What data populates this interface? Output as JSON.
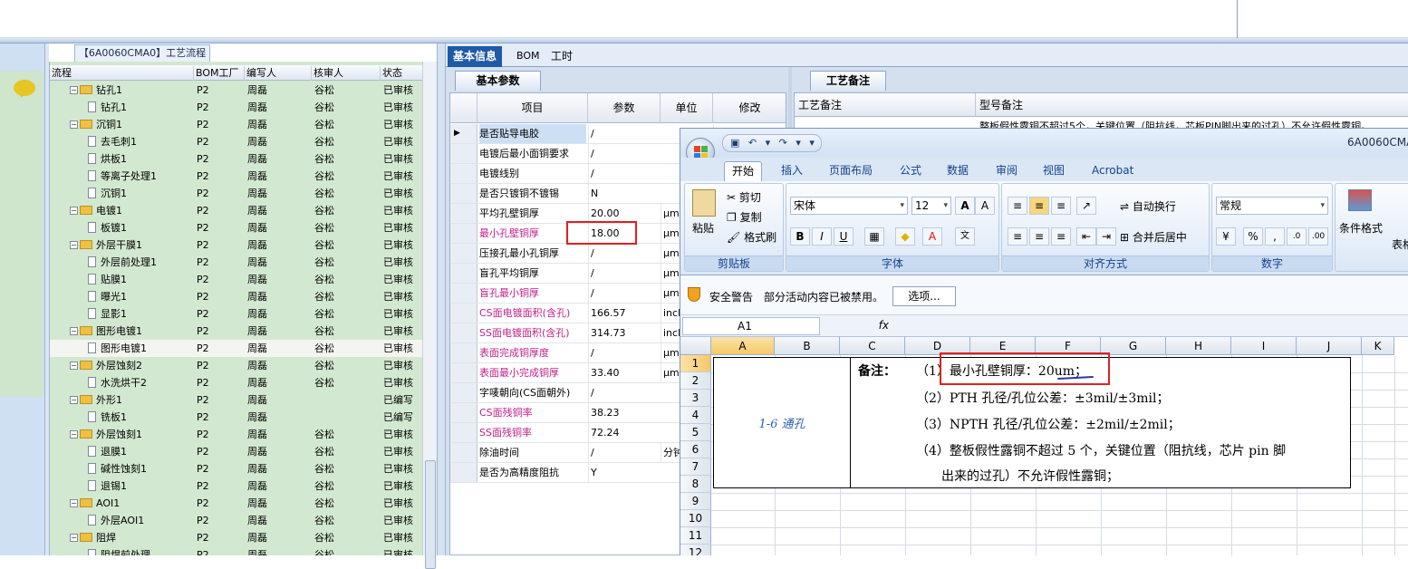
{
  "tree": {
    "title": "【6A0060CMA0】工艺流程",
    "headers": [
      "流程",
      "BOM工厂",
      "编写人",
      "核审人",
      "状态"
    ],
    "rows": [
      {
        "name": "钻孔1",
        "level": 1,
        "bom": "P2",
        "author": "周磊",
        "reviewer": "谷松",
        "status": "已审核"
      },
      {
        "name": "钻孔1",
        "level": 2,
        "bom": "P2",
        "author": "周磊",
        "reviewer": "谷松",
        "status": "已审核"
      },
      {
        "name": "沉铜1",
        "level": 1,
        "bom": "P2",
        "author": "周磊",
        "reviewer": "谷松",
        "status": "已审核"
      },
      {
        "name": "去毛刺1",
        "level": 2,
        "bom": "P2",
        "author": "周磊",
        "reviewer": "谷松",
        "status": "已审核"
      },
      {
        "name": "烘板1",
        "level": 2,
        "bom": "P2",
        "author": "周磊",
        "reviewer": "谷松",
        "status": "已审核"
      },
      {
        "name": "等离子处理1",
        "level": 2,
        "bom": "P2",
        "author": "周磊",
        "reviewer": "谷松",
        "status": "已审核"
      },
      {
        "name": "沉铜1",
        "level": 2,
        "bom": "P2",
        "author": "周磊",
        "reviewer": "谷松",
        "status": "已审核"
      },
      {
        "name": "电镀1",
        "level": 1,
        "bom": "P2",
        "author": "周磊",
        "reviewer": "谷松",
        "status": "已审核"
      },
      {
        "name": "板镀1",
        "level": 2,
        "bom": "P2",
        "author": "周磊",
        "reviewer": "谷松",
        "status": "已审核"
      },
      {
        "name": "外层干膜1",
        "level": 1,
        "bom": "P2",
        "author": "周磊",
        "reviewer": "谷松",
        "status": "已审核"
      },
      {
        "name": "外层前处理1",
        "level": 2,
        "bom": "P2",
        "author": "周磊",
        "reviewer": "谷松",
        "status": "已审核"
      },
      {
        "name": "贴膜1",
        "level": 2,
        "bom": "P2",
        "author": "周磊",
        "reviewer": "谷松",
        "status": "已审核"
      },
      {
        "name": "曝光1",
        "level": 2,
        "bom": "P2",
        "author": "周磊",
        "reviewer": "谷松",
        "status": "已审核"
      },
      {
        "name": "显影1",
        "level": 2,
        "bom": "P2",
        "author": "周磊",
        "reviewer": "谷松",
        "status": "已审核"
      },
      {
        "name": "图形电镀1",
        "level": 1,
        "bom": "P2",
        "author": "周磊",
        "reviewer": "谷松",
        "status": "已审核"
      },
      {
        "name": "图形电镀1",
        "level": 2,
        "bom": "P2",
        "author": "周磊",
        "reviewer": "谷松",
        "status": "已审核"
      },
      {
        "name": "外层蚀刻2",
        "level": 1,
        "bom": "P2",
        "author": "周磊",
        "reviewer": "谷松",
        "status": "已审核"
      },
      {
        "name": "水洗烘干2",
        "level": 2,
        "bom": "P2",
        "author": "周磊",
        "reviewer": "谷松",
        "status": "已审核"
      },
      {
        "name": "外形1",
        "level": 1,
        "bom": "P2",
        "author": "周磊",
        "reviewer": "",
        "status": "已编写"
      },
      {
        "name": "铣板1",
        "level": 2,
        "bom": "P2",
        "author": "周磊",
        "reviewer": "",
        "status": "已编写"
      },
      {
        "name": "外层蚀刻1",
        "level": 1,
        "bom": "P2",
        "author": "周磊",
        "reviewer": "谷松",
        "status": "已审核"
      },
      {
        "name": "退膜1",
        "level": 2,
        "bom": "P2",
        "author": "周磊",
        "reviewer": "谷松",
        "status": "已审核"
      },
      {
        "name": "碱性蚀刻1",
        "level": 2,
        "bom": "P2",
        "author": "周磊",
        "reviewer": "谷松",
        "status": "已审核"
      },
      {
        "name": "退锡1",
        "level": 2,
        "bom": "P2",
        "author": "周磊",
        "reviewer": "谷松",
        "status": "已审核"
      },
      {
        "name": "AOI1",
        "level": 1,
        "bom": "P2",
        "author": "周磊",
        "reviewer": "谷松",
        "status": "已审核"
      },
      {
        "name": "外层AOI1",
        "level": 2,
        "bom": "P2",
        "author": "周磊",
        "reviewer": "谷松",
        "status": "已审核"
      },
      {
        "name": "阻焊",
        "level": 1,
        "bom": "P2",
        "author": "周磊",
        "reviewer": "谷松",
        "status": "已审核"
      },
      {
        "name": "阻焊前处理",
        "level": 2,
        "bom": "P2",
        "author": "周磊",
        "reviewer": "谷松",
        "status": "已审核"
      }
    ]
  },
  "tabs": [
    "基本信息",
    "BOM",
    "工时"
  ],
  "params": {
    "tab": "基本参数",
    "headers": [
      "项目",
      "参数",
      "单位",
      "修改"
    ],
    "rows": [
      {
        "name": "是否贴导电胶",
        "value": "/",
        "unit": "",
        "pink": false
      },
      {
        "name": "电镀后最小面铜要求",
        "value": "/",
        "unit": "",
        "pink": false
      },
      {
        "name": "电镀线别",
        "value": "/",
        "unit": "",
        "pink": false
      },
      {
        "name": "是否只镀铜不镀锡",
        "value": "N",
        "unit": "",
        "pink": false
      },
      {
        "name": "平均孔壁铜厚",
        "value": "20.00",
        "unit": "μm",
        "pink": false
      },
      {
        "name": "最小孔壁铜厚",
        "value": "18.00",
        "unit": "μm",
        "pink": true
      },
      {
        "name": "压接孔最小孔铜厚",
        "value": "/",
        "unit": "μm",
        "pink": false
      },
      {
        "name": "盲孔平均铜厚",
        "value": "/",
        "unit": "μm",
        "pink": false
      },
      {
        "name": "盲孔最小铜厚",
        "value": "/",
        "unit": "μm",
        "pink": true
      },
      {
        "name": "CS面电镀面积(含孔)",
        "value": "166.57",
        "unit": "inch",
        "pink": true
      },
      {
        "name": "SS面电镀面积(含孔)",
        "value": "314.73",
        "unit": "inch",
        "pink": true
      },
      {
        "name": "表面完成铜厚度",
        "value": "/",
        "unit": "μm",
        "pink": true
      },
      {
        "name": "表面最小完成铜厚",
        "value": "33.40",
        "unit": "μm",
        "pink": true
      },
      {
        "name": "字唛朝向(CS面朝外)",
        "value": "/",
        "unit": "",
        "pink": false
      },
      {
        "name": "CS面残铜率",
        "value": "38.23",
        "unit": "",
        "pink": true
      },
      {
        "name": "SS面残铜率",
        "value": "72.24",
        "unit": "",
        "pink": true
      },
      {
        "name": "除油时间",
        "value": "/",
        "unit": "分钟",
        "pink": false
      },
      {
        "name": "是否为高精度阻抗",
        "value": "Y",
        "unit": "",
        "pink": false
      }
    ]
  },
  "remarks": {
    "tab": "工艺备注",
    "headers": [
      "工艺备注",
      "型号备注"
    ],
    "line": "整板假性露铜不超过5个，关键位置（阻抗线，芯板PIN脚出来的过孔）不允许假性露铜。"
  },
  "excel": {
    "doc_title": "6A0060CMA",
    "qat": "▣ ↶ ▾ ↷ ▾ ▾",
    "tabs": [
      "开始",
      "插入",
      "页面布局",
      "公式",
      "数据",
      "审阅",
      "视图",
      "Acrobat"
    ],
    "clipboard": {
      "paste": "粘贴",
      "cut": "剪切",
      "copy": "复制",
      "format_painter": "格式刷",
      "label": "剪贴板"
    },
    "font": {
      "name": "宋体",
      "size": "12",
      "label": "字体"
    },
    "alignment": {
      "wrap": "自动换行",
      "merge": "合并后居中",
      "label": "对齐方式"
    },
    "number": {
      "format": "常规",
      "label": "数字",
      "percent": "%",
      "comma": ","
    },
    "styles": {
      "conditional": "条件格式",
      "table": "表格"
    },
    "warning": {
      "title": "安全警告",
      "message": "部分活动内容已被禁用。",
      "options": "选项..."
    },
    "namebox": "A1",
    "fx": "fx",
    "columns": [
      "A",
      "B",
      "C",
      "D",
      "E",
      "F",
      "G",
      "H",
      "I",
      "J",
      "K"
    ],
    "rows": [
      "1",
      "2",
      "3",
      "4",
      "5",
      "6",
      "7",
      "8",
      "9",
      "10",
      "11",
      "12"
    ],
    "cell_a": "1-6 通孔",
    "note_label": "备注：",
    "notes": [
      "（1）最小孔壁铜厚：20um；",
      "（2）PTH 孔径/孔位公差：±3mil/±3mil；",
      "（3）NPTH 孔径/孔位公差：±2mil/±2mil；",
      "（4）整板假性露铜不超过 5 个，关键位置（阻抗线，芯片 pin 脚",
      "出来的过孔）不允许假性露铜；"
    ]
  }
}
